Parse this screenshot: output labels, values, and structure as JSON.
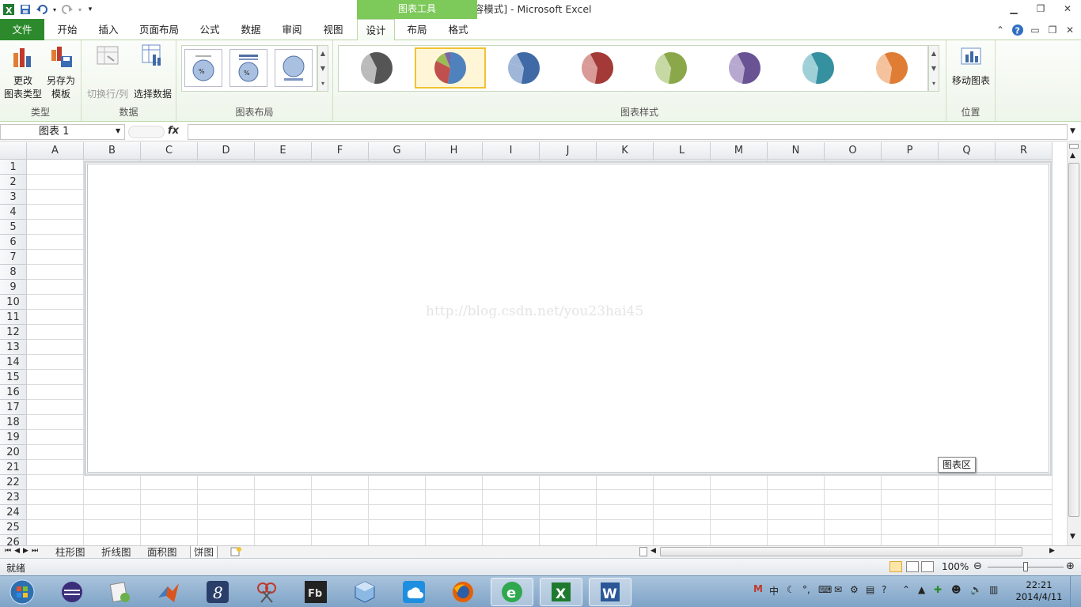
{
  "window": {
    "title": "柱形图.xls  [兼容模式] - Microsoft Excel",
    "context_tab": "图表工具"
  },
  "tabs": [
    {
      "label": "文件"
    },
    {
      "label": "开始"
    },
    {
      "label": "插入"
    },
    {
      "label": "页面布局"
    },
    {
      "label": "公式"
    },
    {
      "label": "数据"
    },
    {
      "label": "审阅"
    },
    {
      "label": "视图"
    },
    {
      "label": "设计"
    },
    {
      "label": "布局"
    },
    {
      "label": "格式"
    }
  ],
  "ribbon": {
    "type_group": {
      "label": "类型",
      "change_type_l1": "更改",
      "change_type_l2": "图表类型",
      "save_template_l1": "另存为",
      "save_template_l2": "模板"
    },
    "data_group": {
      "label": "数据",
      "switch_row_col": "切换行/列",
      "select_data": "选择数据"
    },
    "layout_group": {
      "label": "图表布局"
    },
    "style_group": {
      "label": "图表样式"
    },
    "location_group": {
      "label": "位置",
      "move_chart": "移动图表"
    }
  },
  "chart_styles": [
    {
      "color": "#555555",
      "light": "#bbbbbb"
    },
    {
      "color": "#4f81bd",
      "light": "#c0504d",
      "multi": true
    },
    {
      "color": "#3f6aa6",
      "light": "#9fb6d8"
    },
    {
      "color": "#a33a37",
      "light": "#d99a98"
    },
    {
      "color": "#8aa84a",
      "light": "#c6d8a3"
    },
    {
      "color": "#6a5394",
      "light": "#b7a8cf"
    },
    {
      "color": "#35909f",
      "light": "#9fd0d8"
    },
    {
      "color": "#e07d35",
      "light": "#f4c39d"
    }
  ],
  "formula_bar": {
    "name_box": "图表 1",
    "fx": "fx",
    "value": ""
  },
  "columns": [
    "A",
    "B",
    "C",
    "D",
    "E",
    "F",
    "G",
    "H",
    "I",
    "J",
    "K",
    "L",
    "M",
    "N",
    "O",
    "P",
    "Q",
    "R"
  ],
  "rows": [
    "1",
    "2",
    "3",
    "4",
    "5",
    "6",
    "7",
    "8",
    "9",
    "10",
    "11",
    "12",
    "13",
    "14",
    "15",
    "16",
    "17",
    "18",
    "19",
    "20",
    "21",
    "22",
    "23",
    "24",
    "25",
    "26"
  ],
  "chart": {
    "watermark": "http://blog.csdn.net/you23hai45",
    "tooltip": "图表区"
  },
  "sheets": [
    {
      "label": "柱形图"
    },
    {
      "label": "折线图"
    },
    {
      "label": "面积图"
    },
    {
      "label": "饼图"
    }
  ],
  "status": {
    "ready": "就绪",
    "zoom": "100%"
  },
  "taskbar": {
    "time": "22:21",
    "date": "2014/4/11",
    "ime": "中"
  }
}
